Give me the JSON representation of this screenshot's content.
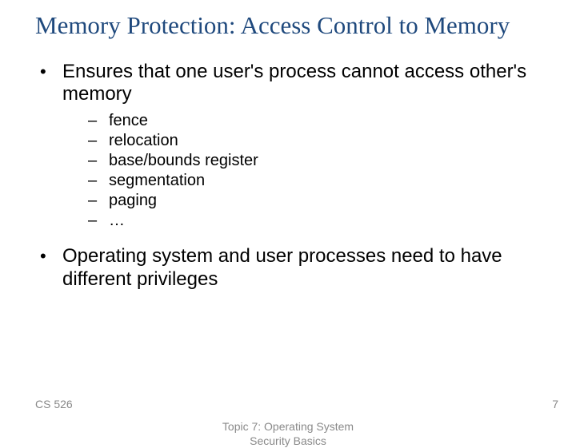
{
  "title": "Memory Protection: Access Control to Memory",
  "bullets": [
    {
      "text": "Ensures that one user's process cannot access other's memory",
      "sub": [
        "fence",
        "relocation",
        "base/bounds register",
        "segmentation",
        "paging",
        "…"
      ]
    },
    {
      "text": "Operating system and user processes need to have different privileges",
      "sub": []
    }
  ],
  "footer": {
    "left": "CS 526",
    "center": "Topic 7: Operating System\nSecurity Basics",
    "right": "7"
  }
}
